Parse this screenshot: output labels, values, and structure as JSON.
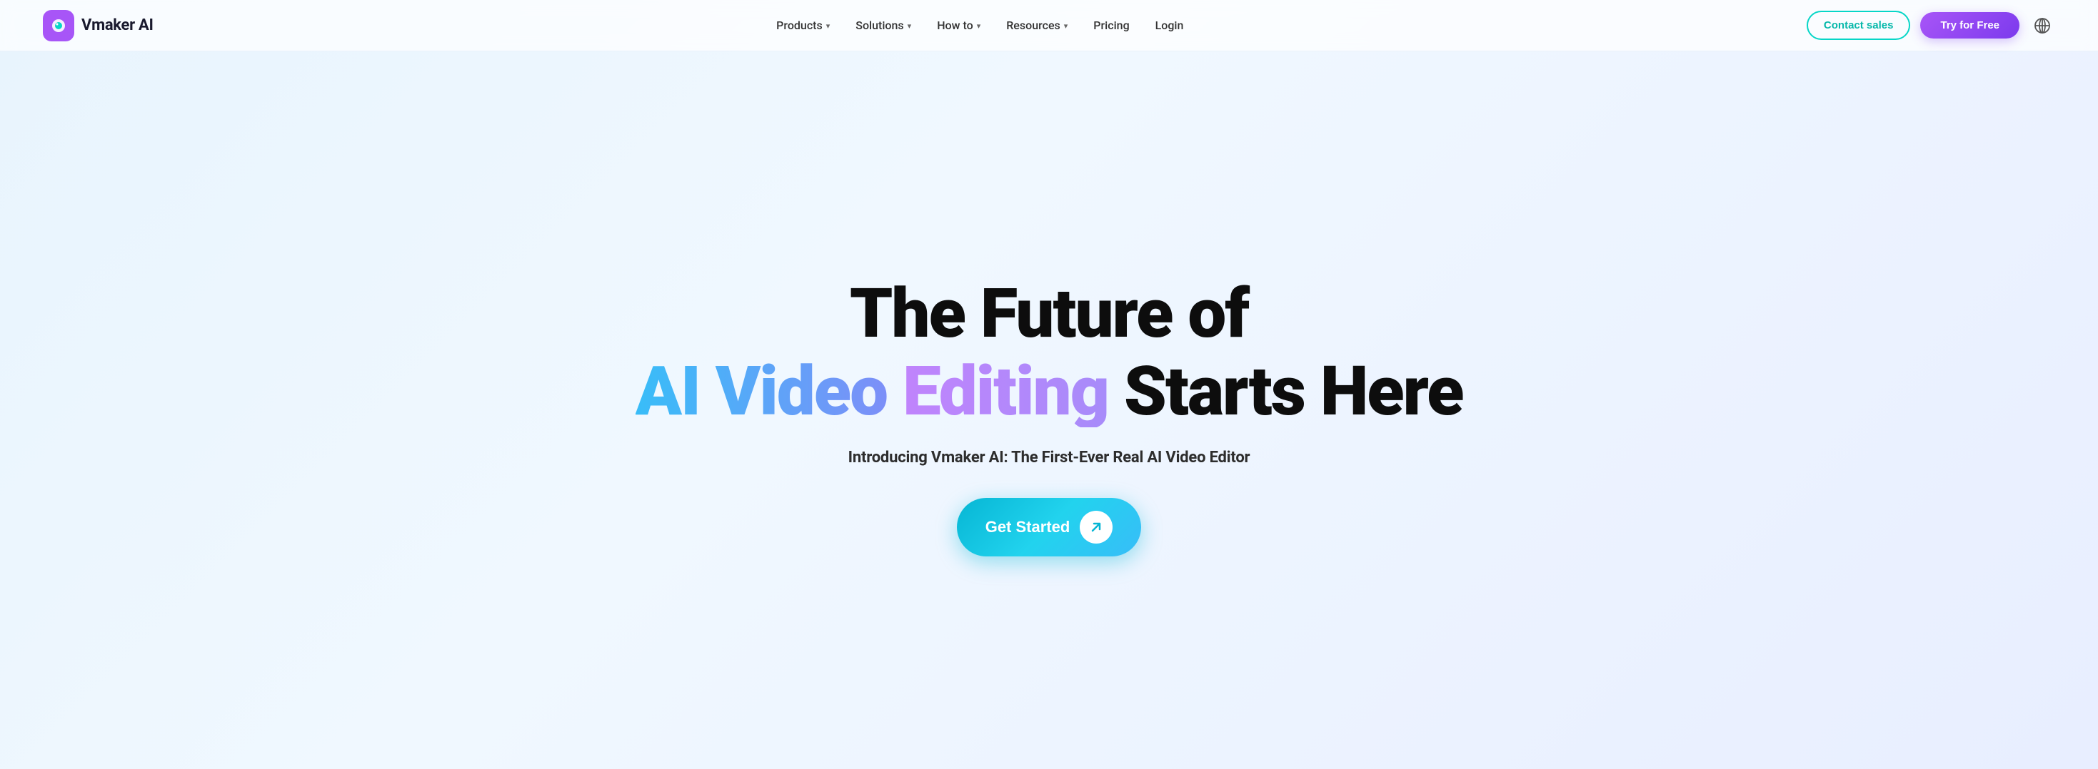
{
  "brand": {
    "name": "Vmaker AI"
  },
  "navbar": {
    "nav_items": [
      {
        "label": "Products",
        "has_dropdown": true
      },
      {
        "label": "Solutions",
        "has_dropdown": true
      },
      {
        "label": "How to",
        "has_dropdown": true
      },
      {
        "label": "Resources",
        "has_dropdown": true
      },
      {
        "label": "Pricing",
        "has_dropdown": false
      },
      {
        "label": "Login",
        "has_dropdown": false
      }
    ],
    "contact_label": "Contact sales",
    "try_label": "Try for Free"
  },
  "hero": {
    "title_line1": "The Future of",
    "title_line2_part1": "AI Video",
    "title_line2_part2": " Editing",
    "title_line2_part3": " Starts Here",
    "subtitle": "Introducing Vmaker AI: The First-Ever Real AI Video Editor",
    "cta_label": "Get Started",
    "arrow_icon": "↗"
  }
}
